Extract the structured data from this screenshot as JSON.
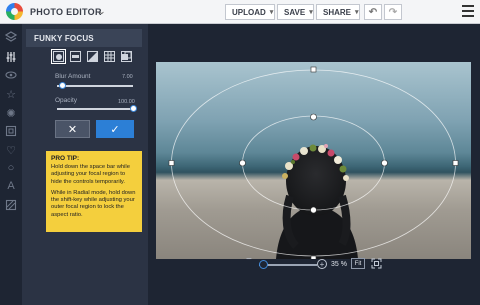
{
  "app": {
    "title": "PHOTO EDITOR"
  },
  "toolbar": {
    "upload": "UPLOAD",
    "save": "SAVE",
    "share": "SHARE"
  },
  "panel": {
    "heading": "FUNKY FOCUS",
    "blur": {
      "label": "Blur Amount",
      "value": "7.00",
      "level": 0.07
    },
    "opacity": {
      "label": "Opacity",
      "value": "100.00",
      "level": 1.0
    },
    "tip_title": "PRO TIP:",
    "tip_p1": "Hold down the space bar while adjusting your focal region to hide the controls temporarily.",
    "tip_p2": "While in Radial mode, hold down the shift-key while adjusting your outer focal region to lock the aspect ratio."
  },
  "zoom": {
    "value": "35 %",
    "fit": "Fit",
    "level": 0.08
  },
  "colors": {
    "accent": "#2c7fd6",
    "tip": "#f4cf3d",
    "panel": "#2b3344",
    "bg": "#1e2533"
  },
  "icons": [
    "layers-icon",
    "adjust-sliders-icon",
    "eye-icon",
    "star-icon",
    "sun-icon",
    "frame-icon",
    "heart-icon",
    "circle-icon",
    "text-icon",
    "texture-icon"
  ]
}
